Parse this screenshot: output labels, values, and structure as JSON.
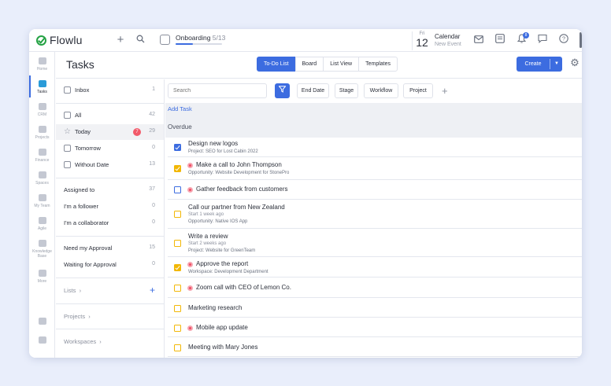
{
  "app": {
    "name": "Flowlu",
    "accent": "#3c6ce0",
    "brand_green": "#25a244"
  },
  "topbar": {
    "add_icon": "plus-icon",
    "search_icon": "search-icon",
    "onboarding": {
      "label": "Onboarding",
      "count": "5/13",
      "progress_fraction": 0.38
    },
    "calendar": {
      "day_of_week": "Fri",
      "day": "12",
      "title": "Calendar",
      "subtitle": "New Event"
    },
    "notifications_count": "8",
    "icons": [
      "mail-icon",
      "notes-icon",
      "bell-icon",
      "chat-icon",
      "help-icon"
    ]
  },
  "leftnav": [
    {
      "label": "Home",
      "icon": "home-icon"
    },
    {
      "label": "Tasks",
      "icon": "tasks-icon",
      "active": true
    },
    {
      "label": "CRM",
      "icon": "crm-icon"
    },
    {
      "label": "Projects",
      "icon": "projects-icon"
    },
    {
      "label": "Finance",
      "icon": "finance-icon"
    },
    {
      "label": "Spaces",
      "icon": "spaces-icon"
    },
    {
      "label": "My Team",
      "icon": "team-icon"
    },
    {
      "label": "Agile",
      "icon": "agile-icon"
    },
    {
      "label": "Knowledge Base",
      "icon": "knowledge-icon"
    },
    {
      "label": "More",
      "icon": "more-icon"
    }
  ],
  "header": {
    "title": "Tasks",
    "tabs": [
      "To-Do List",
      "Board",
      "List View",
      "Templates"
    ],
    "active_tab": "To-Do List",
    "create_label": "Create"
  },
  "sidebar": {
    "inbox": {
      "label": "Inbox",
      "count": "1"
    },
    "all": {
      "label": "All",
      "count": "42"
    },
    "today": {
      "label": "Today",
      "alert": "7",
      "count": "29"
    },
    "tomorrow": {
      "label": "Tomorrow",
      "count": "0"
    },
    "without_date": {
      "label": "Without Date",
      "count": "13"
    },
    "assigned_to": {
      "label": "Assigned to",
      "count": "37"
    },
    "follower": {
      "label": "I'm a follower",
      "count": "0"
    },
    "collaborator": {
      "label": "I'm a collaborator",
      "count": "0"
    },
    "need_approval": {
      "label": "Need my Approval",
      "count": "15"
    },
    "waiting_approval": {
      "label": "Waiting for Approval",
      "count": "0"
    },
    "lists_label": "Lists",
    "projects_label": "Projects",
    "workspaces_label": "Workspaces"
  },
  "filters": {
    "search_placeholder": "Search",
    "chips": [
      "End Date",
      "Stage",
      "Workflow",
      "Project"
    ]
  },
  "content": {
    "add_task": "Add Task",
    "section": "Overdue"
  },
  "tasks": [
    {
      "title": "Design new logos",
      "meta": "Project: SEO for Lost Cabin 2022",
      "check": "blue-checked",
      "priority": false
    },
    {
      "title": "Make a call to John Thompson",
      "meta": "Opportunity: Website Development for StonePro",
      "check": "yellow-checked",
      "priority": true
    },
    {
      "title": "Gather feedback from customers",
      "check": "blue",
      "priority": true
    },
    {
      "title": "Call our partner from New Zealand",
      "start": "Start 1 week ago",
      "meta": "Opportunity: Native IOS App",
      "check": "yellow",
      "priority": false
    },
    {
      "title": "Write a review",
      "start": "Start 2 weeks ago",
      "meta": "Project: Website for GreenTeam",
      "check": "yellow",
      "priority": false
    },
    {
      "title": "Approve the report",
      "meta": "Workspace: Development Department",
      "check": "yellow-checked",
      "priority": true
    },
    {
      "title": "Zoom call with CEO of Lemon Co.",
      "check": "yellow",
      "priority": true
    },
    {
      "title": "Marketing research",
      "check": "yellow",
      "priority": false
    },
    {
      "title": "Mobile app update",
      "check": "yellow",
      "priority": true
    },
    {
      "title": "Meeting with Mary Jones",
      "check": "yellow",
      "priority": false
    }
  ]
}
